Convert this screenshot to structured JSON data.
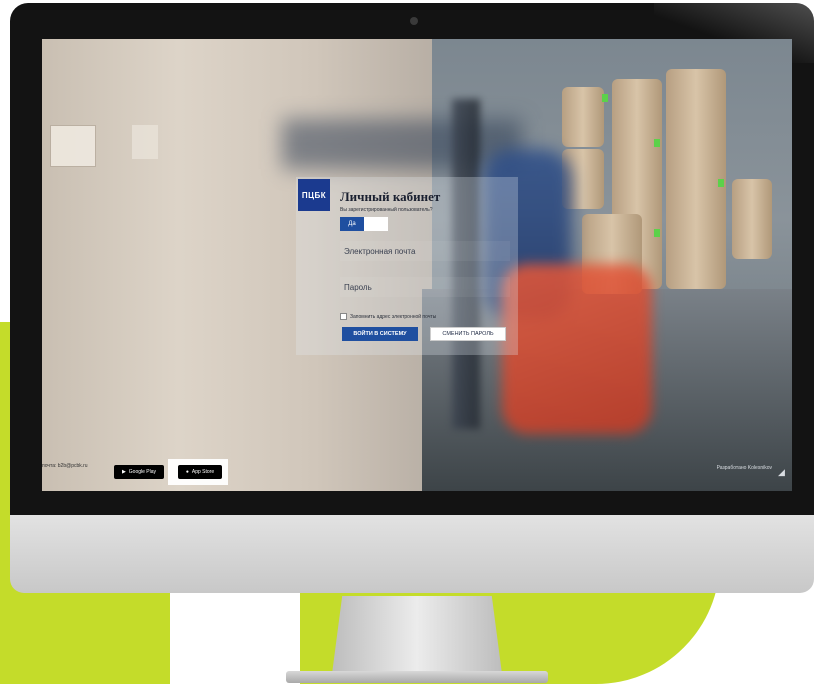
{
  "login": {
    "logo_text": "ПЦБК",
    "title": "Личный кабинет",
    "question": "Вы зарегистрированный пользователь?",
    "toggle_yes": "Да",
    "email_placeholder": "Электронная почта",
    "password_placeholder": "Пароль",
    "remember_label": "Запомнить адрес электронной почты",
    "login_button": "ВОЙТИ В СИСТЕМУ",
    "change_password_button": "СМЕНИТЬ ПАРОЛЬ"
  },
  "footer": {
    "left_text": "почта: b2b@pcbk.ru",
    "google_play": "Google Play",
    "app_store": "App Store",
    "right_text": "Разработано Kolesnikov"
  },
  "colors": {
    "accent": "#1f4fa0",
    "brand_lime": "#c4dc2a",
    "logo_bg": "#1b3a8f"
  },
  "icons": [
    "checkbox-icon",
    "google-play-icon",
    "apple-icon",
    "corner-icon"
  ]
}
